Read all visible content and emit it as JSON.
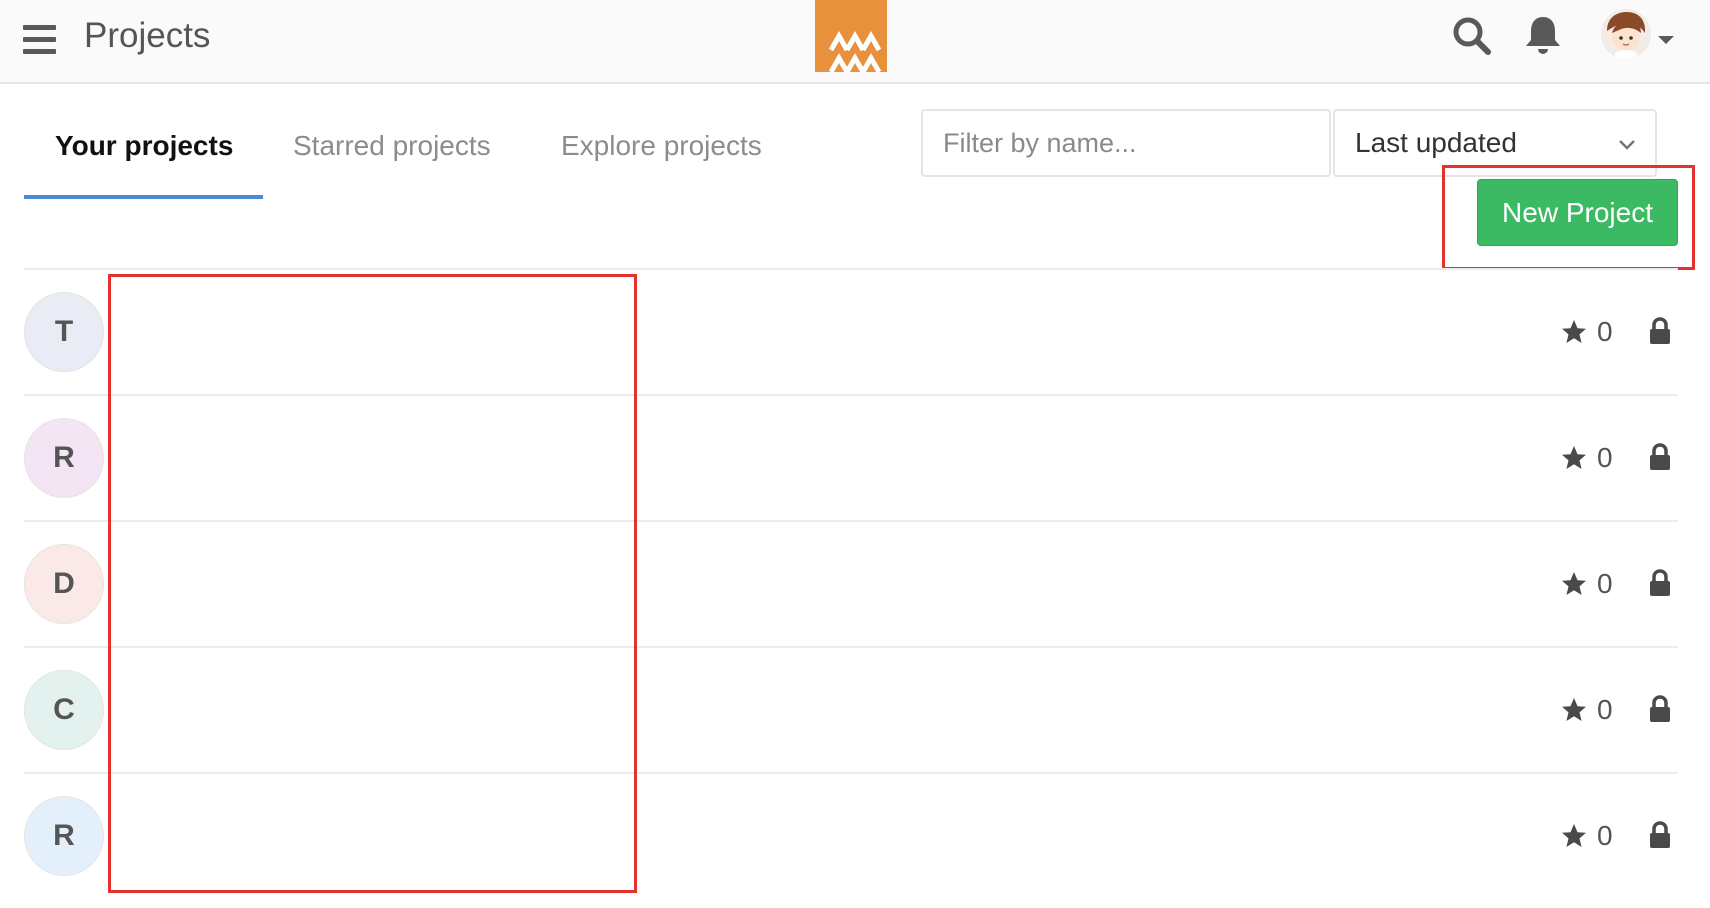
{
  "header": {
    "title": "Projects",
    "logo_color": "#e8913c",
    "icons": [
      "hamburger-menu-icon",
      "search-icon",
      "bell-icon",
      "caret-down-icon"
    ]
  },
  "tabs": [
    {
      "label": "Your projects",
      "active": true
    },
    {
      "label": "Starred projects",
      "active": false
    },
    {
      "label": "Explore projects",
      "active": false
    }
  ],
  "filter": {
    "placeholder": "Filter by name...",
    "value": ""
  },
  "sort": {
    "selected": "Last updated"
  },
  "new_project_label": "New Project",
  "colors": {
    "accent_tab": "#4a8bd8",
    "new_button": "#3cba63",
    "highlight": "#e5322d"
  },
  "projects": [
    {
      "initial": "T",
      "avatar_color": "#e9ebf5",
      "stars": "0",
      "visibility": "private"
    },
    {
      "initial": "R",
      "avatar_color": "#f3e5f4",
      "stars": "0",
      "visibility": "private"
    },
    {
      "initial": "D",
      "avatar_color": "#fbe9e7",
      "stars": "0",
      "visibility": "private"
    },
    {
      "initial": "C",
      "avatar_color": "#e3f2ee",
      "stars": "0",
      "visibility": "private"
    },
    {
      "initial": "R",
      "avatar_color": "#e3f0fc",
      "stars": "0",
      "visibility": "private"
    }
  ]
}
